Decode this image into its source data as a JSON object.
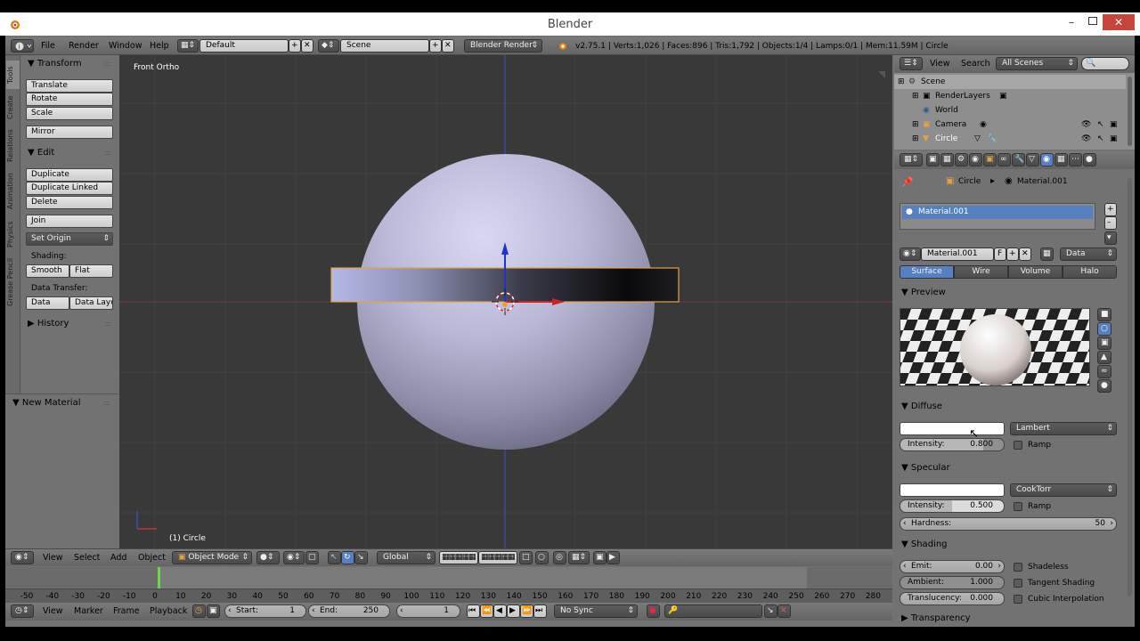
{
  "window": {
    "title": "Blender"
  },
  "info_header": {
    "menus": [
      "File",
      "Render",
      "Window",
      "Help"
    ],
    "layout": "Default",
    "scene": "Scene",
    "engine": "Blender Render",
    "stats": "v2.75.1 | Verts:1,026 | Faces:896 | Tris:1,792 | Objects:1/4 | Lamps:0/1 | Mem:11.59M | Circle"
  },
  "shelf_tabs": [
    "Tools",
    "Create",
    "Relations",
    "Animation",
    "Physics",
    "Grease Pencil"
  ],
  "tool_shelf": {
    "transform": {
      "title": "Transform",
      "buttons": [
        "Translate",
        "Rotate",
        "Scale",
        "Mirror"
      ]
    },
    "edit": {
      "title": "Edit",
      "buttons": [
        "Duplicate",
        "Duplicate Linked",
        "Delete",
        "Join"
      ],
      "set_origin": "Set Origin"
    },
    "shading_label": "Shading:",
    "shading_buttons": [
      "Smooth",
      "Flat"
    ],
    "data_transfer_label": "Data Transfer:",
    "data_transfer_buttons": [
      "Data",
      "Data Layo"
    ],
    "history": "History"
  },
  "new_material_panel": {
    "title": "New Material"
  },
  "viewport": {
    "view_name": "Front Ortho",
    "object_label": "(1) Circle"
  },
  "viewport_header": {
    "menus": [
      "View",
      "Select",
      "Add",
      "Object"
    ],
    "mode": "Object Mode",
    "orientation": "Global"
  },
  "timeline": {
    "ruler": [
      "-50",
      "-40",
      "-30",
      "-20",
      "-10",
      "0",
      "10",
      "20",
      "30",
      "40",
      "50",
      "60",
      "70",
      "80",
      "90",
      "100",
      "110",
      "120",
      "130",
      "140",
      "150",
      "160",
      "170",
      "180",
      "190",
      "200",
      "210",
      "220",
      "230",
      "240",
      "250",
      "260",
      "270",
      "280"
    ],
    "menus": [
      "View",
      "Marker",
      "Frame",
      "Playback"
    ],
    "start_label": "Start:",
    "start": "1",
    "end_label": "End:",
    "end": "250",
    "current": "1",
    "sync": "No Sync"
  },
  "outliner": {
    "menus": [
      "View",
      "Search"
    ],
    "filter": "All Scenes",
    "rows": [
      "Scene",
      "RenderLayers",
      "World",
      "Camera",
      "Circle"
    ]
  },
  "properties": {
    "breadcrumb": [
      "Circle",
      "Material.001"
    ],
    "material_slot": "Material.001",
    "material_name": "Material.001",
    "fake_user": "F",
    "link": "Data",
    "tabs": [
      "Surface",
      "Wire",
      "Volume",
      "Halo"
    ],
    "preview_title": "Preview",
    "diffuse": {
      "title": "Diffuse",
      "shader": "Lambert",
      "intensity_label": "Intensity:",
      "intensity": "0.800",
      "ramp": "Ramp"
    },
    "specular": {
      "title": "Specular",
      "shader": "CookTorr",
      "intensity_label": "Intensity:",
      "intensity": "0.500",
      "ramp": "Ramp",
      "hardness_label": "Hardness:",
      "hardness": "50"
    },
    "shading": {
      "title": "Shading",
      "emit_label": "Emit:",
      "emit": "0.00",
      "ambient_label": "Ambient:",
      "ambient": "1.000",
      "translucency_label": "Translucency:",
      "translucency": "0.000",
      "shadeless": "Shadeless",
      "tangent_shading": "Tangent Shading",
      "cubic_interpolation": "Cubic Interpolation"
    },
    "transparency_title": "Transparency"
  }
}
